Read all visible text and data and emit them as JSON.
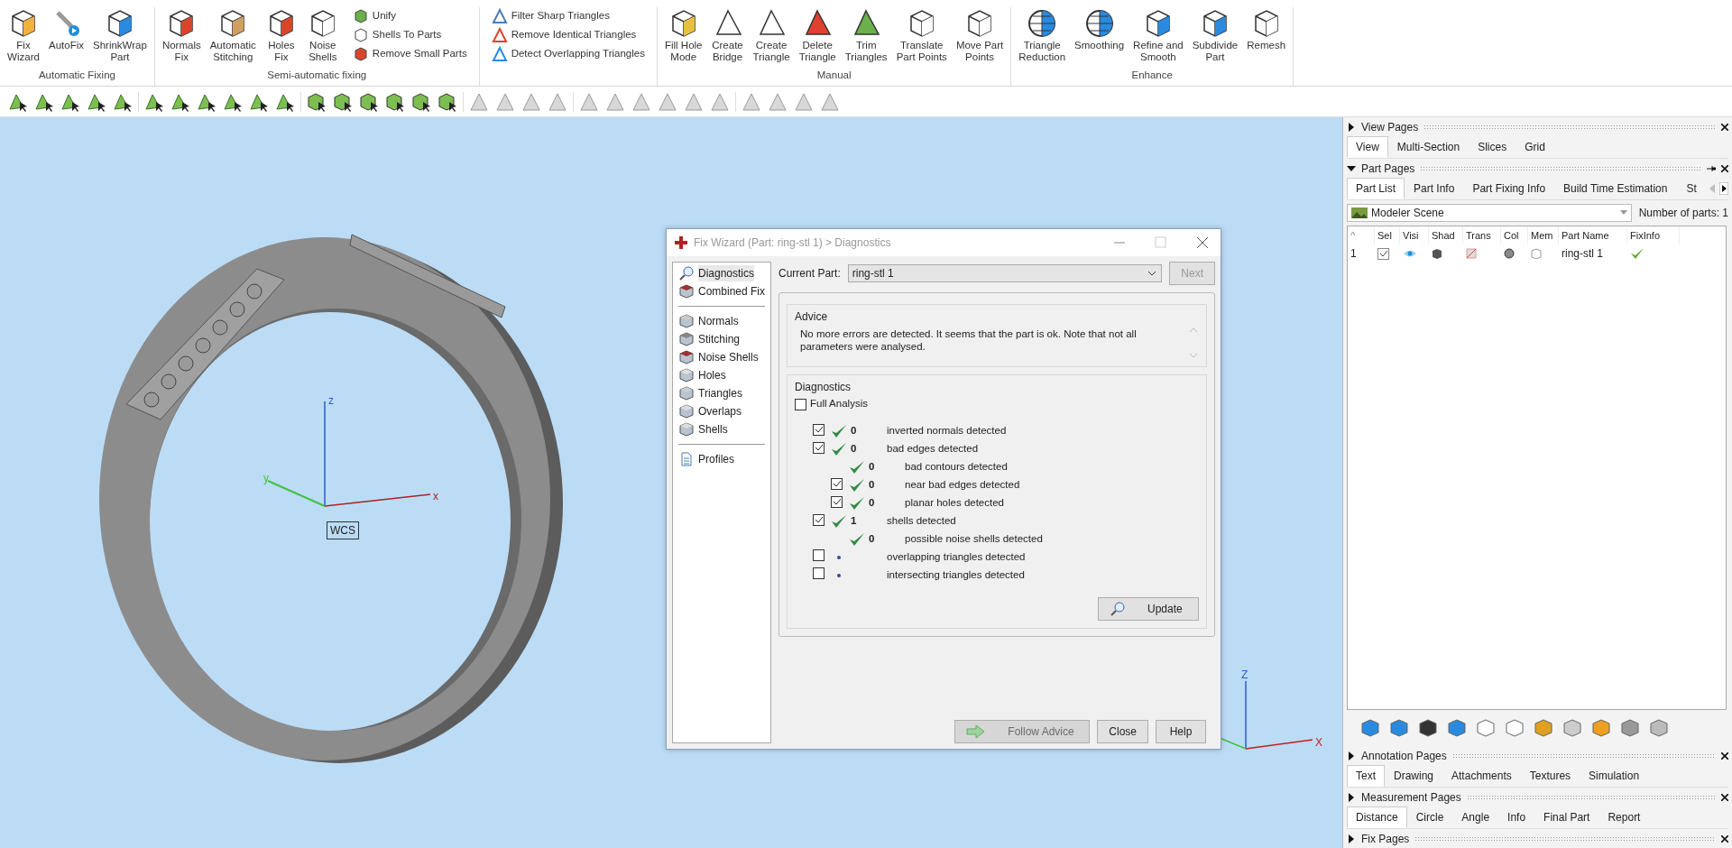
{
  "ribbon": {
    "groups": [
      {
        "label": "Automatic Fixing",
        "buttons": [
          {
            "label": "Fix\nWizard"
          },
          {
            "label": "AutoFix"
          },
          {
            "label": "ShrinkWrap\nPart"
          }
        ]
      },
      {
        "label": "Semi-automatic fixing",
        "buttons": [
          {
            "label": "Normals\nFix"
          },
          {
            "label": "Automatic\nStitching"
          },
          {
            "label": "Holes\nFix"
          },
          {
            "label": "Noise\nShells"
          }
        ],
        "small_buttons": [
          {
            "label": "Unify"
          },
          {
            "label": "Shells To Parts"
          },
          {
            "label": "Remove Small Parts"
          }
        ]
      },
      {
        "small_buttons": [
          {
            "label": "Filter Sharp Triangles"
          },
          {
            "label": "Remove Identical Triangles"
          },
          {
            "label": "Detect Overlapping Triangles"
          }
        ]
      },
      {
        "label": "Manual",
        "buttons": [
          {
            "label": "Fill Hole\nMode"
          },
          {
            "label": "Create\nBridge"
          },
          {
            "label": "Create\nTriangle"
          },
          {
            "label": "Delete\nTriangle"
          },
          {
            "label": "Trim\nTriangles"
          },
          {
            "label": "Translate\nPart Points"
          },
          {
            "label": "Move Part\nPoints"
          }
        ]
      },
      {
        "label": "Enhance",
        "buttons": [
          {
            "label": "Triangle\nReduction"
          },
          {
            "label": "Smoothing"
          },
          {
            "label": "Refine and\nSmooth"
          },
          {
            "label": "Subdivide\nPart"
          },
          {
            "label": "Remesh"
          }
        ]
      }
    ]
  },
  "viewport": {
    "axis_labels": [
      "z",
      "y",
      "x"
    ],
    "wcs_label": "WCS",
    "corner_axis_labels": [
      "Z",
      "X"
    ]
  },
  "dialog": {
    "title": "Fix Wizard (Part: ring-stl 1) > Diagnostics",
    "nav": [
      [
        {
          "label": "Diagnostics",
          "selected": true
        },
        {
          "label": "Combined Fix",
          "selected": false
        }
      ],
      [
        {
          "label": "Normals",
          "selected": false
        },
        {
          "label": "Stitching",
          "selected": false
        },
        {
          "label": "Noise Shells",
          "selected": false
        },
        {
          "label": "Holes",
          "selected": false
        },
        {
          "label": "Triangles",
          "selected": false
        },
        {
          "label": "Overlaps",
          "selected": false
        },
        {
          "label": "Shells",
          "selected": false
        }
      ],
      [
        {
          "label": "Profiles",
          "selected": false
        }
      ]
    ],
    "current_part_label": "Current Part:",
    "current_part": "ring-stl 1",
    "next_button": {
      "label": "Next",
      "disabled": true
    },
    "advice": {
      "title": "Advice",
      "text": "No more errors are detected. It seems that the part is ok. Note that not all parameters were analysed."
    },
    "diagnostics": {
      "title": "Diagnostics",
      "full_analysis": {
        "label": "Full Analysis",
        "checked": false
      },
      "items": [
        {
          "kind": "checkbox",
          "checked": true,
          "passed": true,
          "count": "0",
          "label": "inverted normals detected"
        },
        {
          "kind": "checkbox",
          "checked": true,
          "passed": true,
          "count": "0",
          "label": "bad edges detected",
          "children": [
            {
              "kind": "plain",
              "passed": true,
              "count": "0",
              "label": "bad contours detected"
            },
            {
              "kind": "checkbox",
              "checked": true,
              "passed": true,
              "count": "0",
              "label": "near bad edges detected"
            },
            {
              "kind": "checkbox",
              "checked": true,
              "passed": true,
              "count": "0",
              "label": "planar holes detected"
            }
          ]
        },
        {
          "kind": "checkbox",
          "checked": true,
          "passed": true,
          "count": "1",
          "label": "shells detected",
          "children": [
            {
              "kind": "plain",
              "passed": true,
              "count": "0",
              "label": "possible noise shells detected"
            }
          ]
        },
        {
          "kind": "checkbox",
          "checked": false,
          "passed": false,
          "label": "overlapping triangles detected"
        },
        {
          "kind": "checkbox",
          "checked": false,
          "passed": false,
          "label": "intersecting triangles detected"
        }
      ]
    },
    "update_button": "Update",
    "follow_advice_button": {
      "label": "Follow Advice",
      "disabled": true
    },
    "buttons": [
      "Close",
      "Help"
    ]
  },
  "panel": {
    "view_pages": {
      "title": "View Pages",
      "expanded": false,
      "tabs": [
        {
          "label": "View",
          "selected": true
        },
        {
          "label": "Multi-Section",
          "selected": false
        },
        {
          "label": "Slices",
          "selected": false
        },
        {
          "label": "Grid",
          "selected": false
        }
      ]
    },
    "part_pages": {
      "title": "Part Pages",
      "expanded": true,
      "tabs": [
        {
          "label": "Part List",
          "selected": true
        },
        {
          "label": "Part Info",
          "selected": false
        },
        {
          "label": "Part Fixing Info",
          "selected": false
        },
        {
          "label": "Build Time Estimation",
          "selected": false
        },
        {
          "label": "St",
          "selected": false
        }
      ],
      "scene": "Modeler Scene",
      "parts_count": "Number of parts: 1",
      "columns": [
        "^",
        "Sel",
        "Visi",
        "Shad",
        "Trans",
        "Col",
        "Mem",
        "Part Name",
        "FixInfo"
      ],
      "rows": [
        {
          "index": "1",
          "checked": true,
          "name": "ring-stl 1"
        }
      ]
    },
    "annotation_pages": {
      "title": "Annotation Pages",
      "expanded": false,
      "tabs": [
        {
          "label": "Text",
          "selected": true
        },
        {
          "label": "Drawing",
          "selected": false
        },
        {
          "label": "Attachments",
          "selected": false
        },
        {
          "label": "Textures",
          "selected": false
        },
        {
          "label": "Simulation",
          "selected": false
        }
      ]
    },
    "measurement_pages": {
      "title": "Measurement Pages",
      "expanded": false,
      "tabs": [
        {
          "label": "Distance",
          "selected": true
        },
        {
          "label": "Circle",
          "selected": false
        },
        {
          "label": "Angle",
          "selected": false
        },
        {
          "label": "Info",
          "selected": false
        },
        {
          "label": "Final Part",
          "selected": false
        },
        {
          "label": "Report",
          "selected": false
        }
      ]
    },
    "fix_pages": {
      "title": "Fix Pages",
      "expanded": false
    }
  }
}
